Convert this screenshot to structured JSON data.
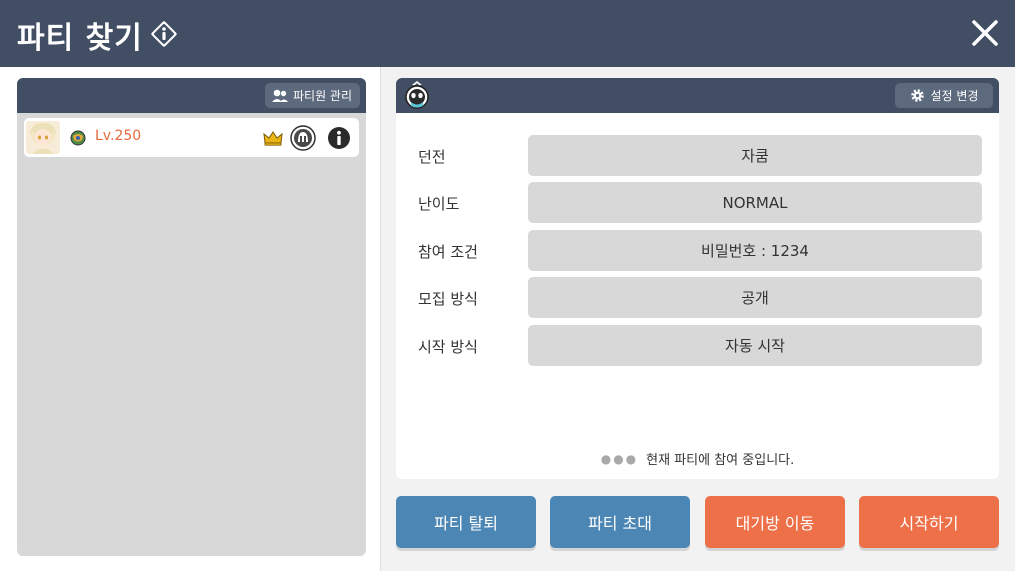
{
  "header": {
    "title": "파티 찾기",
    "info_icon": "info-diamond-icon",
    "close_icon": "close-icon"
  },
  "members": {
    "manage_label": "파티원 관리",
    "list": [
      {
        "level": "Lv.250",
        "is_leader": true
      }
    ]
  },
  "details": {
    "settings_label": "설정 변경",
    "fields": [
      {
        "label": "던전",
        "value": "자쿰"
      },
      {
        "label": "난이도",
        "value": "NORMAL"
      },
      {
        "label": "참여 조건",
        "value": "비밀번호 : 1234"
      },
      {
        "label": "모집 방식",
        "value": "공개"
      },
      {
        "label": "시작 방식",
        "value": "자동 시작"
      }
    ],
    "status": "현재 파티에 참여 중입니다."
  },
  "actions": {
    "leave": "파티 탈퇴",
    "invite": "파티 초대",
    "move_waiting_room": "대기방 이동",
    "start": "시작하기"
  },
  "colors": {
    "header_bg": "#414e63",
    "button_blue": "#4b86b4",
    "button_orange": "#ee7048",
    "level_text": "#e46a3a"
  }
}
